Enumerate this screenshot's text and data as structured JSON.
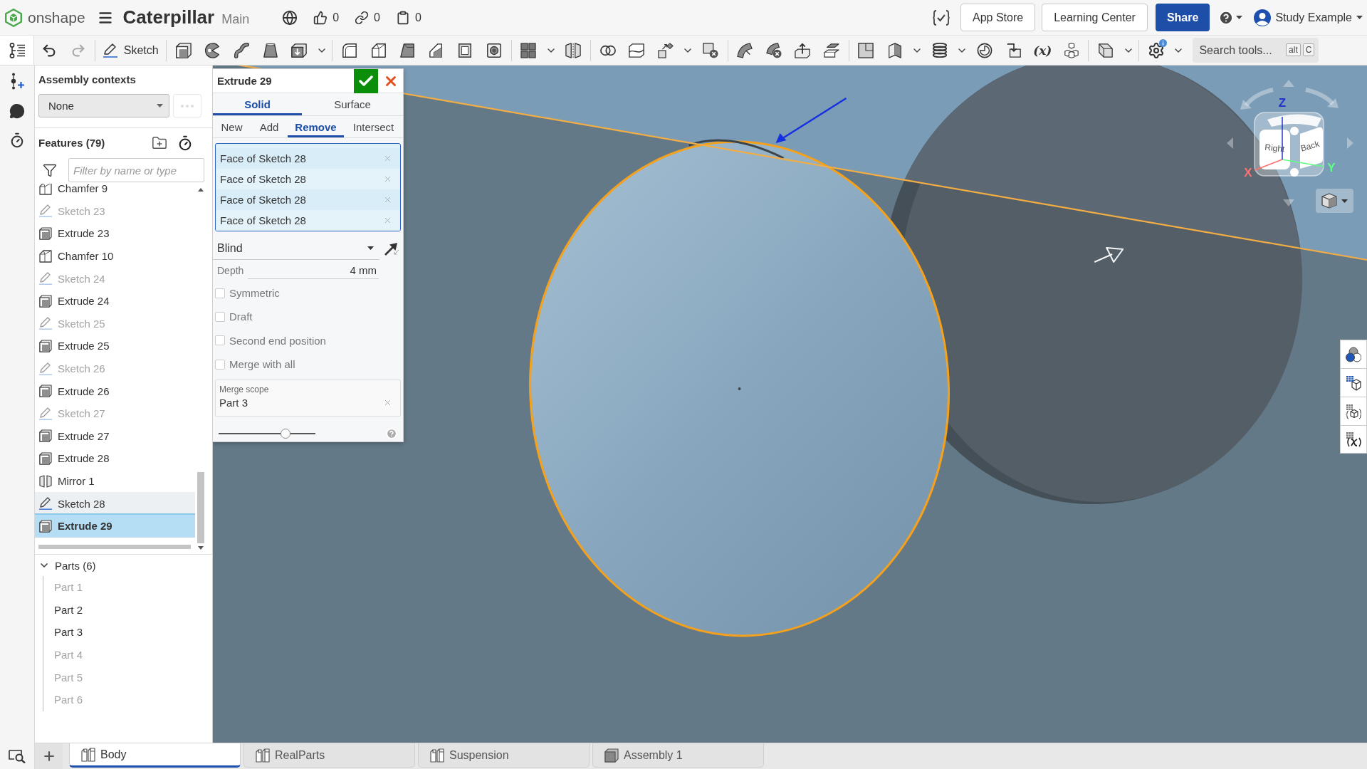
{
  "top_bar": {
    "logo_text": "onshape",
    "document_title": "Caterpillar",
    "branch": "Main",
    "counters": [
      {
        "kind": "likes",
        "count": "0"
      },
      {
        "kind": "links",
        "count": "0"
      },
      {
        "kind": "copies",
        "count": "0"
      }
    ],
    "buttons": [
      "App Store",
      "Learning Center"
    ],
    "share_button": "Share",
    "user_name": "Study Example"
  },
  "toolbar": {
    "sketch_label": "Sketch",
    "variable_label": "(x)",
    "search": {
      "placeholder": "Search tools...",
      "keys": [
        "alt",
        "C"
      ]
    }
  },
  "feature_panel": {
    "assembly_contexts": {
      "title": "Assembly contexts",
      "value": "None"
    },
    "features": {
      "title": "Features (79)",
      "filter": {
        "placeholder": "Filter by name or type"
      },
      "items": [
        {
          "kind": "chamfer",
          "label": "Chamfer 9",
          "dimmed": false,
          "highlighted": false,
          "selected": false
        },
        {
          "kind": "sketch",
          "label": "Sketch 23",
          "dimmed": true,
          "highlighted": false,
          "selected": false
        },
        {
          "kind": "extrude",
          "label": "Extrude 23",
          "dimmed": false,
          "highlighted": false,
          "selected": false
        },
        {
          "kind": "chamfer",
          "label": "Chamfer 10",
          "dimmed": false,
          "highlighted": false,
          "selected": false
        },
        {
          "kind": "sketch",
          "label": "Sketch 24",
          "dimmed": true,
          "highlighted": false,
          "selected": false
        },
        {
          "kind": "extrude",
          "label": "Extrude 24",
          "dimmed": false,
          "highlighted": false,
          "selected": false
        },
        {
          "kind": "sketch",
          "label": "Sketch 25",
          "dimmed": true,
          "highlighted": false,
          "selected": false
        },
        {
          "kind": "extrude",
          "label": "Extrude 25",
          "dimmed": false,
          "highlighted": false,
          "selected": false
        },
        {
          "kind": "sketch",
          "label": "Sketch 26",
          "dimmed": true,
          "highlighted": false,
          "selected": false
        },
        {
          "kind": "extrude",
          "label": "Extrude 26",
          "dimmed": false,
          "highlighted": false,
          "selected": false
        },
        {
          "kind": "sketch",
          "label": "Sketch 27",
          "dimmed": true,
          "highlighted": false,
          "selected": false
        },
        {
          "kind": "extrude",
          "label": "Extrude 27",
          "dimmed": false,
          "highlighted": false,
          "selected": false
        },
        {
          "kind": "extrude",
          "label": "Extrude 28",
          "dimmed": false,
          "highlighted": false,
          "selected": false
        },
        {
          "kind": "mirror",
          "label": "Mirror 1",
          "dimmed": false,
          "highlighted": false,
          "selected": false
        },
        {
          "kind": "sketch",
          "label": "Sketch 28",
          "dimmed": false,
          "highlighted": true,
          "selected": false
        },
        {
          "kind": "extrude",
          "label": "Extrude 29",
          "dimmed": false,
          "highlighted": false,
          "selected": true
        }
      ]
    },
    "parts": {
      "title": "Parts (6)",
      "expanded": true,
      "items": [
        {
          "label": "Part 1",
          "dimmed": true
        },
        {
          "label": "Part 2",
          "dimmed": false
        },
        {
          "label": "Part 3",
          "dimmed": false
        },
        {
          "label": "Part 4",
          "dimmed": true
        },
        {
          "label": "Part 5",
          "dimmed": true
        },
        {
          "label": "Part 6",
          "dimmed": true
        }
      ]
    }
  },
  "extrude_dialog": {
    "title": "Extrude 29",
    "body_types": [
      {
        "label": "Solid",
        "selected": true
      },
      {
        "label": "Surface",
        "selected": false
      }
    ],
    "operations": [
      {
        "label": "New",
        "selected": false
      },
      {
        "label": "Add",
        "selected": false
      },
      {
        "label": "Remove",
        "selected": true
      },
      {
        "label": "Intersect",
        "selected": false
      }
    ],
    "selections": [
      "Face of Sketch 28",
      "Face of Sketch 28",
      "Face of Sketch 28",
      "Face of Sketch 28"
    ],
    "end_type": "Blind",
    "depth": {
      "label": "Depth",
      "value": "4 mm"
    },
    "options": [
      {
        "label": "Symmetric",
        "checked": false
      },
      {
        "label": "Draft",
        "checked": false
      },
      {
        "label": "Second end position",
        "checked": false
      },
      {
        "label": "Merge with all",
        "checked": false
      }
    ],
    "merge_scope": {
      "label": "Merge scope",
      "value": "Part 3"
    },
    "slider": {
      "level": 0.69
    }
  },
  "view_cube": {
    "faces": [
      "Right",
      "Back"
    ],
    "axes": [
      {
        "label": "X",
        "color": "#ff7070"
      },
      {
        "label": "Y",
        "color": "#5dff80"
      },
      {
        "label": "Z",
        "color": "#2436c8"
      }
    ]
  },
  "tabs": [
    {
      "kind": "part_studio",
      "label": "Body",
      "selected": true
    },
    {
      "kind": "part_studio",
      "label": "RealParts",
      "selected": false
    },
    {
      "kind": "part_studio",
      "label": "Suspension",
      "selected": false
    },
    {
      "kind": "assembly",
      "label": "Assembly 1",
      "selected": false
    }
  ]
}
